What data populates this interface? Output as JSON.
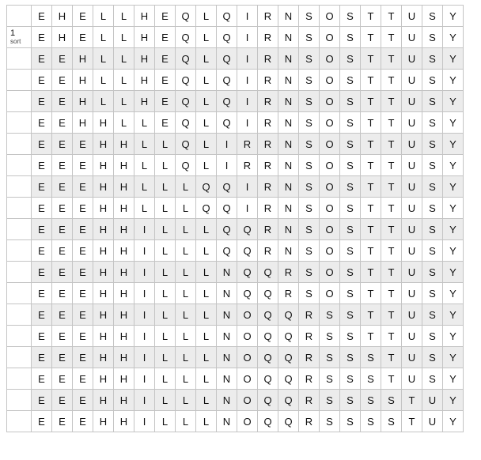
{
  "colors": {
    "shaded_row": "#ececec",
    "grid_line": "#c4c4c4",
    "text": "#111111"
  },
  "rows": [
    {
      "label": "",
      "sublabel": "",
      "shaded": false,
      "cells": [
        "E",
        "H",
        "E",
        "L",
        "L",
        "H",
        "E",
        "Q",
        "L",
        "Q",
        "I",
        "R",
        "N",
        "S",
        "O",
        "S",
        "T",
        "T",
        "U",
        "S",
        "Y"
      ]
    },
    {
      "label": "1",
      "sublabel": "sort",
      "shaded": false,
      "cells": [
        "E",
        "H",
        "E",
        "L",
        "L",
        "H",
        "E",
        "Q",
        "L",
        "Q",
        "I",
        "R",
        "N",
        "S",
        "O",
        "S",
        "T",
        "T",
        "U",
        "S",
        "Y"
      ]
    },
    {
      "label": "",
      "sublabel": "",
      "shaded": true,
      "cells": [
        "E",
        "E",
        "H",
        "L",
        "L",
        "H",
        "E",
        "Q",
        "L",
        "Q",
        "I",
        "R",
        "N",
        "S",
        "O",
        "S",
        "T",
        "T",
        "U",
        "S",
        "Y"
      ]
    },
    {
      "label": "",
      "sublabel": "",
      "shaded": false,
      "cells": [
        "E",
        "E",
        "H",
        "L",
        "L",
        "H",
        "E",
        "Q",
        "L",
        "Q",
        "I",
        "R",
        "N",
        "S",
        "O",
        "S",
        "T",
        "T",
        "U",
        "S",
        "Y"
      ]
    },
    {
      "label": "",
      "sublabel": "",
      "shaded": true,
      "cells": [
        "E",
        "E",
        "H",
        "L",
        "L",
        "H",
        "E",
        "Q",
        "L",
        "Q",
        "I",
        "R",
        "N",
        "S",
        "O",
        "S",
        "T",
        "T",
        "U",
        "S",
        "Y"
      ]
    },
    {
      "label": "",
      "sublabel": "",
      "shaded": false,
      "cells": [
        "E",
        "E",
        "H",
        "H",
        "L",
        "L",
        "E",
        "Q",
        "L",
        "Q",
        "I",
        "R",
        "N",
        "S",
        "O",
        "S",
        "T",
        "T",
        "U",
        "S",
        "Y"
      ]
    },
    {
      "label": "",
      "sublabel": "",
      "shaded": true,
      "cells": [
        "E",
        "E",
        "E",
        "H",
        "H",
        "L",
        "L",
        "Q",
        "L",
        "I",
        "R",
        "R",
        "N",
        "S",
        "O",
        "S",
        "T",
        "T",
        "U",
        "S",
        "Y"
      ]
    },
    {
      "label": "",
      "sublabel": "",
      "shaded": false,
      "cells": [
        "E",
        "E",
        "E",
        "H",
        "H",
        "L",
        "L",
        "Q",
        "L",
        "I",
        "R",
        "R",
        "N",
        "S",
        "O",
        "S",
        "T",
        "T",
        "U",
        "S",
        "Y"
      ]
    },
    {
      "label": "",
      "sublabel": "",
      "shaded": true,
      "cells": [
        "E",
        "E",
        "E",
        "H",
        "H",
        "L",
        "L",
        "L",
        "Q",
        "Q",
        "I",
        "R",
        "N",
        "S",
        "O",
        "S",
        "T",
        "T",
        "U",
        "S",
        "Y"
      ]
    },
    {
      "label": "",
      "sublabel": "",
      "shaded": false,
      "cells": [
        "E",
        "E",
        "E",
        "H",
        "H",
        "L",
        "L",
        "L",
        "Q",
        "Q",
        "I",
        "R",
        "N",
        "S",
        "O",
        "S",
        "T",
        "T",
        "U",
        "S",
        "Y"
      ]
    },
    {
      "label": "",
      "sublabel": "",
      "shaded": true,
      "cells": [
        "E",
        "E",
        "E",
        "H",
        "H",
        "I",
        "L",
        "L",
        "L",
        "Q",
        "Q",
        "R",
        "N",
        "S",
        "O",
        "S",
        "T",
        "T",
        "U",
        "S",
        "Y"
      ]
    },
    {
      "label": "",
      "sublabel": "",
      "shaded": false,
      "cells": [
        "E",
        "E",
        "E",
        "H",
        "H",
        "I",
        "L",
        "L",
        "L",
        "Q",
        "Q",
        "R",
        "N",
        "S",
        "O",
        "S",
        "T",
        "T",
        "U",
        "S",
        "Y"
      ]
    },
    {
      "label": "",
      "sublabel": "",
      "shaded": true,
      "cells": [
        "E",
        "E",
        "E",
        "H",
        "H",
        "I",
        "L",
        "L",
        "L",
        "N",
        "Q",
        "Q",
        "R",
        "S",
        "O",
        "S",
        "T",
        "T",
        "U",
        "S",
        "Y"
      ]
    },
    {
      "label": "",
      "sublabel": "",
      "shaded": false,
      "cells": [
        "E",
        "E",
        "E",
        "H",
        "H",
        "I",
        "L",
        "L",
        "L",
        "N",
        "Q",
        "Q",
        "R",
        "S",
        "O",
        "S",
        "T",
        "T",
        "U",
        "S",
        "Y"
      ]
    },
    {
      "label": "",
      "sublabel": "",
      "shaded": true,
      "cells": [
        "E",
        "E",
        "E",
        "H",
        "H",
        "I",
        "L",
        "L",
        "L",
        "N",
        "O",
        "Q",
        "Q",
        "R",
        "S",
        "S",
        "T",
        "T",
        "U",
        "S",
        "Y"
      ]
    },
    {
      "label": "",
      "sublabel": "",
      "shaded": false,
      "cells": [
        "E",
        "E",
        "E",
        "H",
        "H",
        "I",
        "L",
        "L",
        "L",
        "N",
        "O",
        "Q",
        "Q",
        "R",
        "S",
        "S",
        "T",
        "T",
        "U",
        "S",
        "Y"
      ]
    },
    {
      "label": "",
      "sublabel": "",
      "shaded": true,
      "cells": [
        "E",
        "E",
        "E",
        "H",
        "H",
        "I",
        "L",
        "L",
        "L",
        "N",
        "O",
        "Q",
        "Q",
        "R",
        "S",
        "S",
        "S",
        "T",
        "U",
        "S",
        "Y"
      ]
    },
    {
      "label": "",
      "sublabel": "",
      "shaded": false,
      "cells": [
        "E",
        "E",
        "E",
        "H",
        "H",
        "I",
        "L",
        "L",
        "L",
        "N",
        "O",
        "Q",
        "Q",
        "R",
        "S",
        "S",
        "S",
        "T",
        "U",
        "S",
        "Y"
      ]
    },
    {
      "label": "",
      "sublabel": "",
      "shaded": true,
      "cells": [
        "E",
        "E",
        "E",
        "H",
        "H",
        "I",
        "L",
        "L",
        "L",
        "N",
        "O",
        "Q",
        "Q",
        "R",
        "S",
        "S",
        "S",
        "S",
        "T",
        "U",
        "Y"
      ]
    },
    {
      "label": "",
      "sublabel": "",
      "shaded": false,
      "cells": [
        "E",
        "E",
        "E",
        "H",
        "H",
        "I",
        "L",
        "L",
        "L",
        "N",
        "O",
        "Q",
        "Q",
        "R",
        "S",
        "S",
        "S",
        "S",
        "T",
        "U",
        "Y"
      ]
    }
  ]
}
